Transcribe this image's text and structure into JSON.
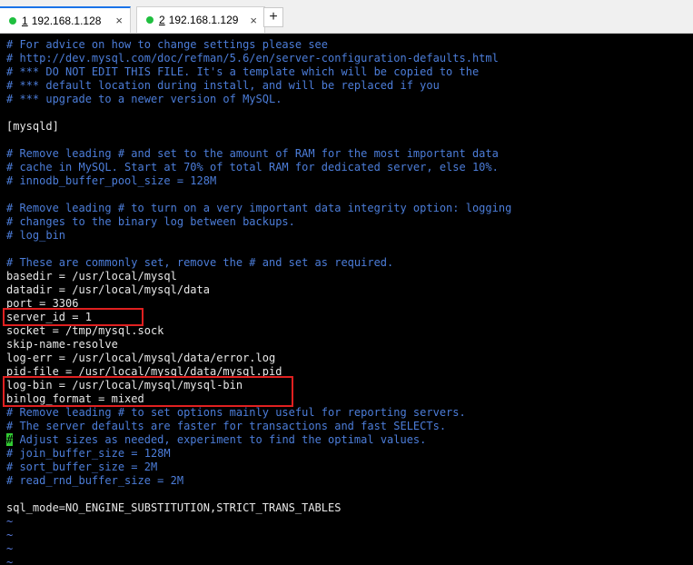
{
  "tabs": [
    {
      "number": "1",
      "label": "192.168.1.128"
    },
    {
      "number": "2",
      "label": "192.168.1.129"
    }
  ],
  "tab_close_glyph": "×",
  "new_tab_glyph": "+",
  "status_color": "#1fbf3f",
  "highlight_color": "#e02020",
  "terminal": {
    "lines": [
      "# For advice on how to change settings please see",
      "# http://dev.mysql.com/doc/refman/5.6/en/server-configuration-defaults.html",
      "# *** DO NOT EDIT THIS FILE. It's a template which will be copied to the",
      "# *** default location during install, and will be replaced if you",
      "# *** upgrade to a newer version of MySQL.",
      "",
      "[mysqld]",
      "",
      "# Remove leading # and set to the amount of RAM for the most important data",
      "# cache in MySQL. Start at 70% of total RAM for dedicated server, else 10%.",
      "# innodb_buffer_pool_size = 128M",
      "",
      "# Remove leading # to turn on a very important data integrity option: logging",
      "# changes to the binary log between backups.",
      "# log_bin",
      "",
      "# These are commonly set, remove the # and set as required.",
      "basedir = /usr/local/mysql",
      "datadir = /usr/local/mysql/data",
      "port = 3306",
      "server_id = 1",
      "socket = /tmp/mysql.sock",
      "skip-name-resolve",
      "log-err = /usr/local/mysql/data/error.log",
      "pid-file = /usr/local/mysql/data/mysql.pid",
      "log-bin = /usr/local/mysql/mysql-bin",
      "binlog_format = mixed",
      "# Remove leading # to set options mainly useful for reporting servers.",
      "# The server defaults are faster for transactions and fast SELECTs.",
      " Adjust sizes as needed, experiment to find the optimal values.",
      "# join_buffer_size = 128M",
      "# sort_buffer_size = 2M",
      "# read_rnd_buffer_size = 2M",
      "",
      "sql_mode=NO_ENGINE_SUBSTITUTION,STRICT_TRANS_TABLES",
      "~",
      "~",
      "~",
      "~"
    ],
    "cursor_char": "#"
  }
}
